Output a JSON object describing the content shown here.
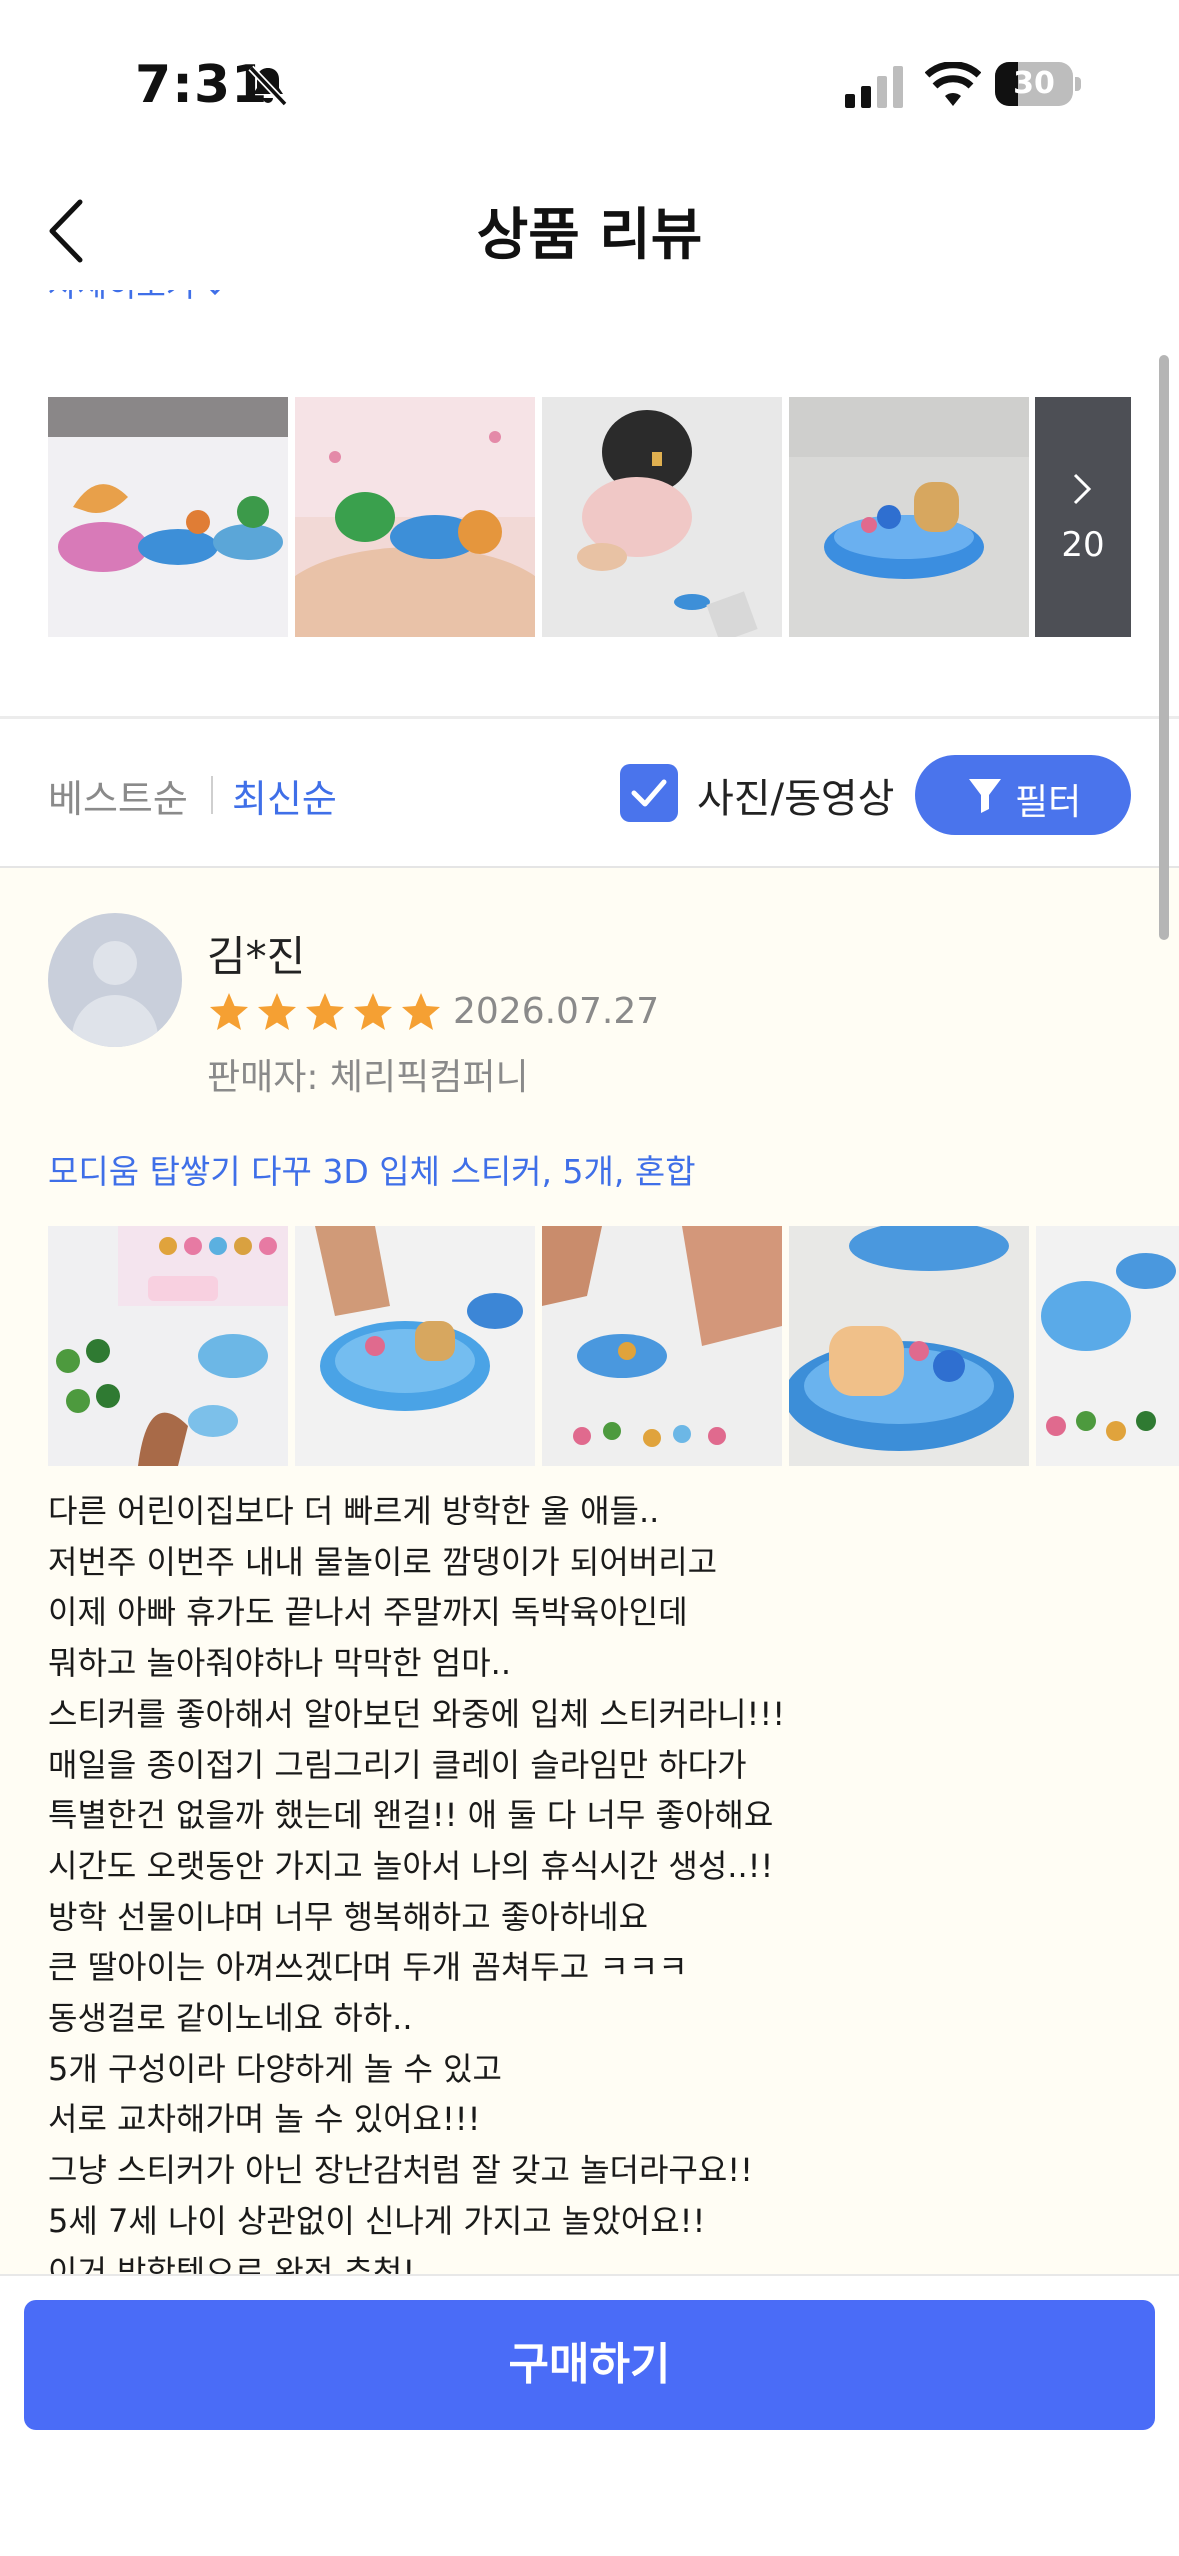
{
  "status": {
    "time": "7:31",
    "battery_level": "30",
    "battery_fraction": 0.3
  },
  "nav": {
    "title": "상품 리뷰"
  },
  "summary": {
    "detail_link": "자세히보기"
  },
  "top_photos": {
    "more_count": "20"
  },
  "sort": {
    "best": "베스트순",
    "newest": "최신순",
    "photo_only_label": "사진/동영상",
    "photo_only_checked": true,
    "filter_label": "필터"
  },
  "review": {
    "reviewer": "김*진",
    "rating": 5,
    "date": "2026.07.27",
    "seller": "판매자: 체리픽컴퍼니",
    "product_option": "모디움 탑쌓기 다꾸 3D 입체 스티커, 5개, 혼합",
    "lines": [
      "다른 어린이집보다 더 빠르게 방학한 울 애들..",
      "저번주 이번주 내내 물놀이로 깜댕이가 되어버리고",
      "이제 아빠 휴가도 끝나서 주말까지 독박육아인데",
      "뭐하고 놀아줘야하나 막막한 엄마..",
      "스티커를 좋아해서 알아보던 와중에 입체 스티커라니!!!",
      "매일을 종이접기 그림그리기 클레이 슬라임만 하다가",
      "특별한건 없을까 했는데 왠걸!! 애 둘 다 너무 좋아해요",
      "시간도 오랫동안 가지고 놀아서 나의 휴식시간 생성..!!",
      "방학 선물이냐며 너무 행복해하고 좋아하네요",
      "큰 딸아이는 아껴쓰겠다며 두개 꼼쳐두고 ㅋㅋㅋ",
      "동생걸로 같이노네요 하하..",
      "5개 구성이라 다양하게 놀 수 있고",
      "서로 교차해가며 놀 수 있어요!!!",
      "그냥 스티커가 아닌 장난감처럼 잘 갖고 놀더라구요!!",
      "5세 7세 나이 상관없이 신나게 가지고 놀았어요!!",
      "이거 방학템으로 완전 추천!"
    ]
  },
  "bottom": {
    "buy_label": "구매하기"
  },
  "colors": {
    "accent": "#4a74ec",
    "buy_button": "#4a6cf7",
    "link": "#3f6fe8",
    "star": "#f5a033",
    "review_bg": "#fffdf4"
  }
}
